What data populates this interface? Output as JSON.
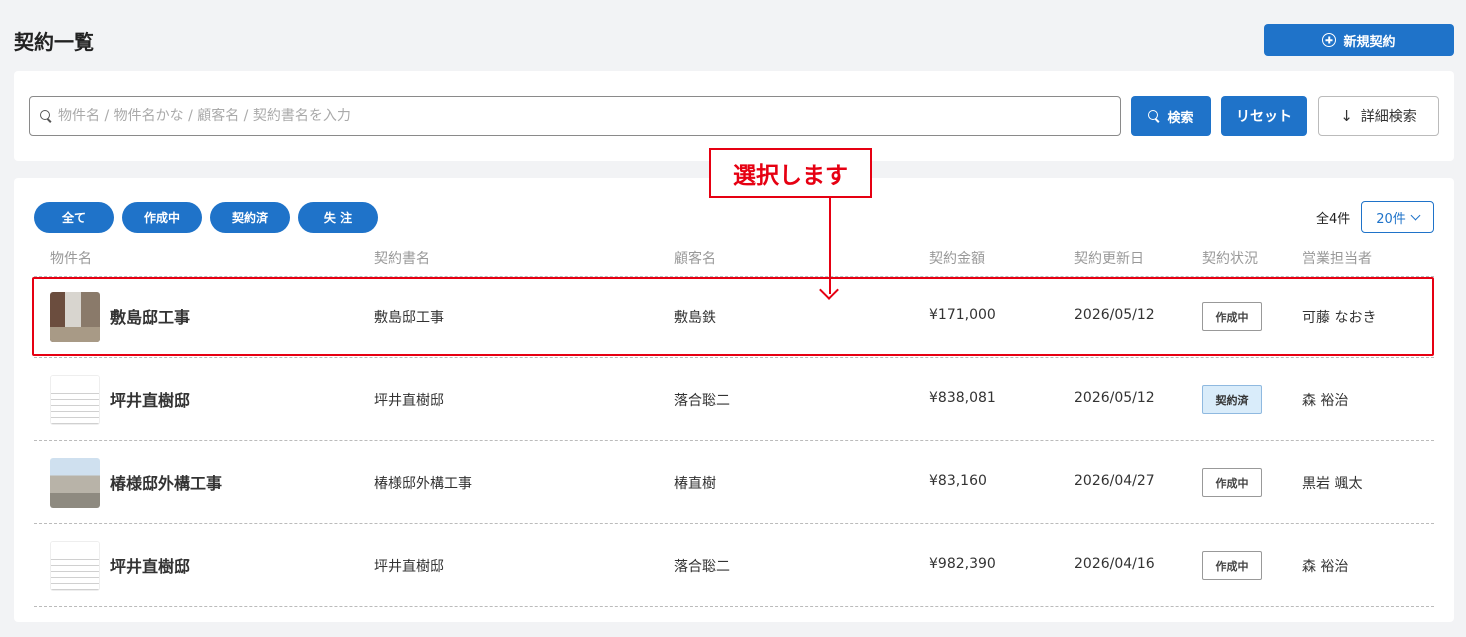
{
  "page": {
    "title": "契約一覧",
    "new_button_label": "新規契約"
  },
  "search": {
    "placeholder": "物件名 / 物件名かな / 顧客名 / 契約書名を入力",
    "search_label": "検索",
    "reset_label": "リセット",
    "advanced_label": "詳細検索"
  },
  "filters": [
    "全て",
    "作成中",
    "契約済",
    "失 注"
  ],
  "total_count": "全4件",
  "per_page": "20件",
  "columns": [
    "物件名",
    "契約書名",
    "顧客名",
    "契約金額",
    "契約更新日",
    "契約状況",
    "営業担当者"
  ],
  "rows": [
    {
      "name": "敷島邸工事",
      "contract": "敷島邸工事",
      "customer": "敷島鉄",
      "amount": "¥171,000",
      "date": "2026/05/12",
      "status": "作成中",
      "rep": "可藤 なおき"
    },
    {
      "name": "坪井直樹邸",
      "contract": "坪井直樹邸",
      "customer": "落合聡二",
      "amount": "¥838,081",
      "date": "2026/05/12",
      "status": "契約済",
      "rep": "森 裕治"
    },
    {
      "name": "椿様邸外構工事",
      "contract": "椿様邸外構工事",
      "customer": "椿直樹",
      "amount": "¥83,160",
      "date": "2026/04/27",
      "status": "作成中",
      "rep": "黒岩 颯太"
    },
    {
      "name": "坪井直樹邸",
      "contract": "坪井直樹邸",
      "customer": "落合聡二",
      "amount": "¥982,390",
      "date": "2026/04/16",
      "status": "作成中",
      "rep": "森 裕治"
    }
  ],
  "annotation": {
    "callout_text": "選択します"
  }
}
